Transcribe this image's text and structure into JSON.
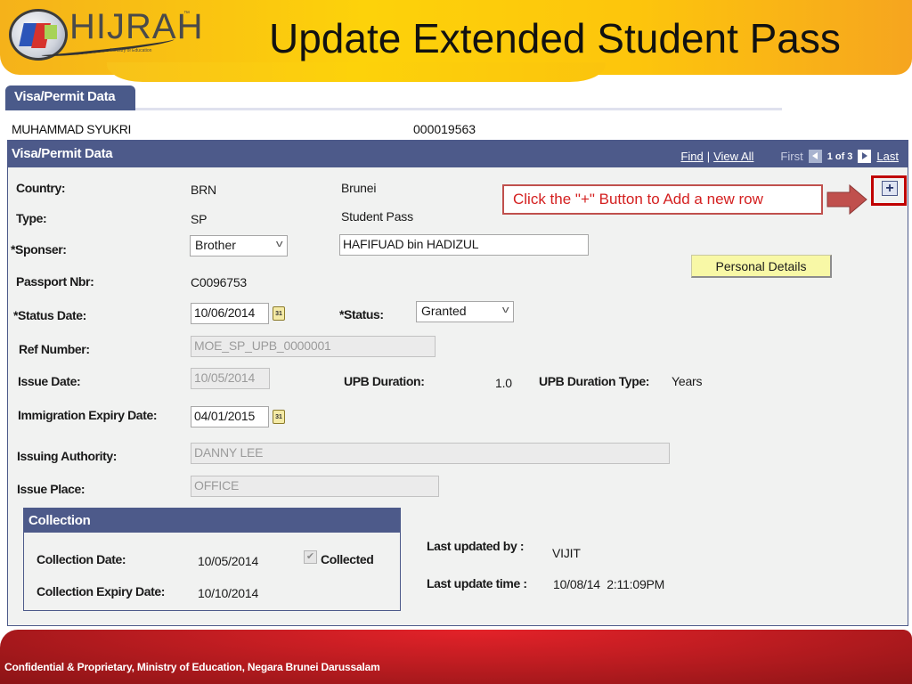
{
  "header": {
    "logo_text": "HIJRAH",
    "logo_tagline": "Ministry of Education",
    "title": "Update Extended Student Pass"
  },
  "tab": {
    "label": "Visa/Permit Data"
  },
  "student": {
    "name": "MUHAMMAD SYUKRI",
    "id": "000019563"
  },
  "panel": {
    "title": "Visa/Permit Data",
    "nav": {
      "find": "Find",
      "separator": "|",
      "view_all": "View All",
      "first": "First",
      "count": "1 of 3",
      "last": "Last"
    }
  },
  "fields": {
    "country": {
      "label": "Country:",
      "code": "BRN",
      "name": "Brunei"
    },
    "type": {
      "label": "Type:",
      "code": "SP",
      "name": "Student Pass"
    },
    "sponser": {
      "label": "*Sponser:",
      "selected": "Brother",
      "name_value": "HAFIFUAD bin HADIZUL"
    },
    "passport": {
      "label": "Passport Nbr:",
      "value": "C0096753"
    },
    "status_date": {
      "label": "*Status Date:",
      "value": "10/06/2014",
      "calendar_icon": "31"
    },
    "status": {
      "label": "*Status:",
      "selected": "Granted"
    },
    "ref_number": {
      "label": "Ref Number:",
      "value": "MOE_SP_UPB_0000001"
    },
    "issue_date": {
      "label": "Issue Date:",
      "value": "10/05/2014"
    },
    "upb_duration": {
      "label": "UPB Duration:",
      "value": "1.0"
    },
    "upb_duration_type": {
      "label": "UPB Duration Type:",
      "value": "Years"
    },
    "immigration_expiry": {
      "label": "Immigration Expiry Date:",
      "value": "04/01/2015",
      "calendar_icon": "31"
    },
    "issuing_authority": {
      "label": "Issuing Authority:",
      "value": "DANNY LEE"
    },
    "issue_place": {
      "label": "Issue Place:",
      "value": "OFFICE"
    }
  },
  "buttons": {
    "personal_details": "Personal Details",
    "add_row": "+"
  },
  "callout": {
    "text": "Click the \"+\" Button to Add a new row",
    "color": "#d42020",
    "highlight_color": "#c00000"
  },
  "collection": {
    "title": "Collection",
    "collection_date": {
      "label": "Collection Date:",
      "value": "10/05/2014"
    },
    "collected": {
      "label": "Collected",
      "checked": true,
      "check_glyph": "✔"
    },
    "collection_expiry": {
      "label": "Collection Expiry Date:",
      "value": "10/10/2014"
    }
  },
  "audit": {
    "last_updated_by": {
      "label": "Last updated by :",
      "value": "VIJIT"
    },
    "last_update_time": {
      "label": "Last update time :",
      "value": "10/08/14  2:11:09PM"
    }
  },
  "footer": {
    "text": "Confidential & Proprietary, Ministry of Education, Negara Brunei Darussalam"
  },
  "colors": {
    "brand_yellow": "#fdd20a",
    "panel_header": "#4d5a8a",
    "footer_red": "#c21d22"
  }
}
